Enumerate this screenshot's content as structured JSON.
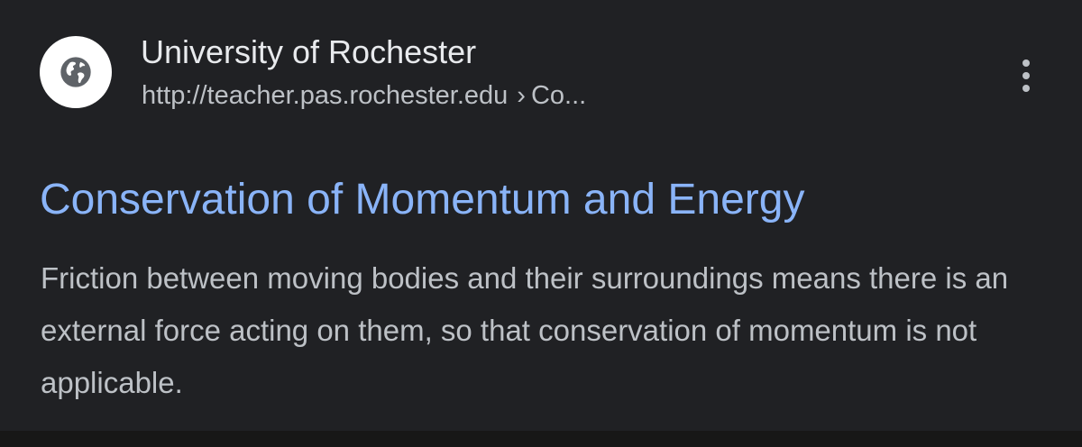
{
  "result": {
    "site_name": "University of Rochester",
    "url_host": "http://teacher.pas.rochester.edu",
    "url_separator": "›",
    "url_path": "Co...",
    "favicon_icon": "globe-icon",
    "menu_icon": "more-vert-icon",
    "title": "Conservation of Momentum and Energy",
    "snippet": "Friction between moving bodies and their surroundings means there is an external force acting on them, so that conservation of momentum is not applicable."
  },
  "colors": {
    "background": "#202124",
    "title_link": "#8ab4f8",
    "text_primary": "#e8eaed",
    "text_secondary": "#bdc1c6",
    "favicon_bg": "#ffffff",
    "globe": "#5f6368"
  }
}
